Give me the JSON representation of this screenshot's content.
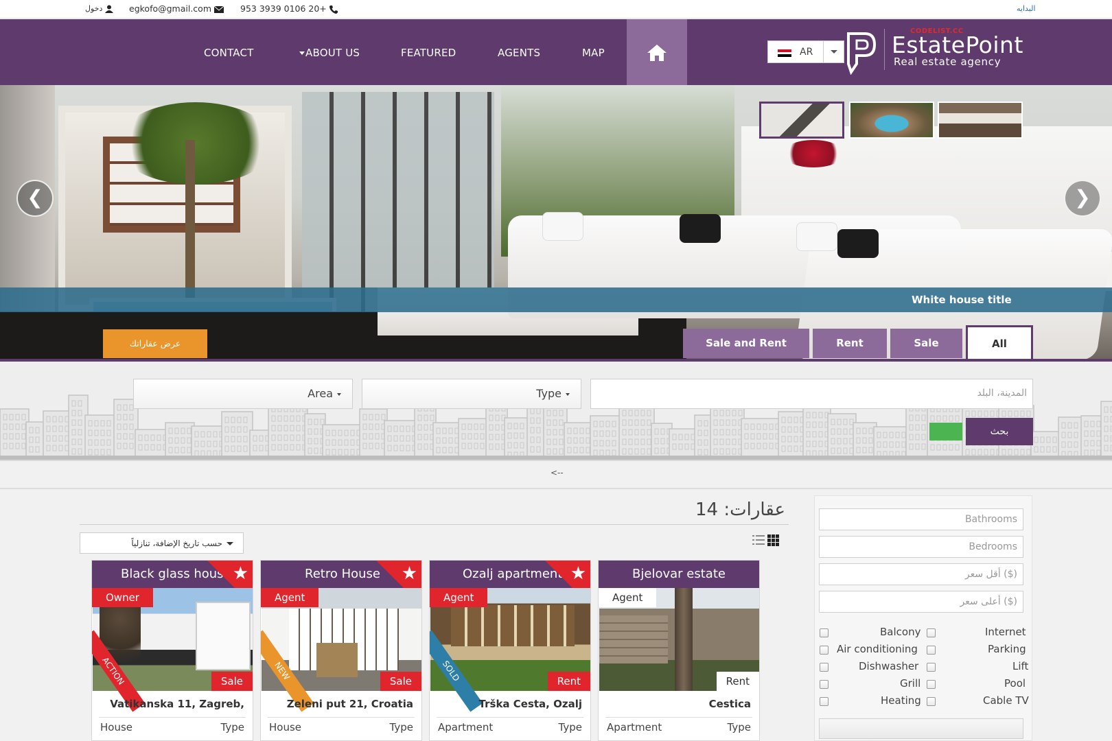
{
  "topbar": {
    "login": "دخول",
    "email": "egkofo@gmail.com",
    "phone": "953 3939 0106 20+",
    "home_link": "البدايه"
  },
  "nav": {
    "items": [
      "CONTACT",
      "ABOUT US",
      "FEATURED",
      "AGENTS",
      "MAP"
    ],
    "home_icon": "home-icon",
    "language": "AR"
  },
  "logo": {
    "sub": "CODELIST.CC",
    "title": "EstatePoint",
    "tagline": "Real estate agency"
  },
  "hero": {
    "caption": "White house title",
    "prev": "❮",
    "next": "❯",
    "thumbnails": [
      "living-room-thumbnail",
      "pool-thumbnail",
      "bedroom-thumbnail"
    ]
  },
  "offer_button": "عرض عقاراتك",
  "tabs": [
    {
      "label": "Sale and Rent"
    },
    {
      "label": "Rent"
    },
    {
      "label": "Sale"
    },
    {
      "label": "All",
      "active": true
    }
  ],
  "search": {
    "area": "Area",
    "type": "Type",
    "city_placeholder": "المدينة، البلد",
    "button": "بحث"
  },
  "toggle": "<--",
  "listing": {
    "count_label": "عقارات: 14",
    "sort": "حسب تاريخ الإضافة، تنازلياً"
  },
  "cards": [
    {
      "title": "Black glass house",
      "role": "Owner",
      "deal": "Sale",
      "ribbon": "ACTION",
      "address": "Vatikanska 11, Zagreb,",
      "ptype": "House",
      "type_label": "Type",
      "featured": true
    },
    {
      "title": "Retro House",
      "role": "Agent",
      "deal": "Sale",
      "ribbon": "NEW",
      "address": "Zeleni put 21, Croatia",
      "ptype": "House",
      "type_label": "Type",
      "featured": true
    },
    {
      "title": "Ozalj apartment",
      "role": "Agent",
      "deal": "Rent",
      "ribbon": "SOLD",
      "address": "Trška Cesta, Ozalj",
      "ptype": "Apartment",
      "type_label": "Type",
      "featured": true
    },
    {
      "title": "Bjelovar estate",
      "role": "Agent",
      "deal": "Rent",
      "ribbon": "",
      "address": "Cestica",
      "ptype": "Apartment",
      "type_label": "Type",
      "featured": false
    }
  ],
  "sidebar": {
    "bathrooms": "Bathrooms",
    "bedrooms": "Bedrooms",
    "min_price": "أقل سعر ($)",
    "max_price": "أعلى سعر ($)",
    "features_left": [
      "Balcony",
      "Air conditioning",
      "Dishwasher",
      "Grill",
      "Heating"
    ],
    "features_right": [
      "Internet",
      "Parking",
      "Lift",
      "Pool",
      "Cable TV"
    ]
  },
  "colors": {
    "primary": "#5e3a6d",
    "primary_light": "#8c6a9a",
    "accent_red": "#e0262c",
    "accent_orange": "#e9952b",
    "caption_blue": "#2d6c8c",
    "green": "#4cb552"
  }
}
